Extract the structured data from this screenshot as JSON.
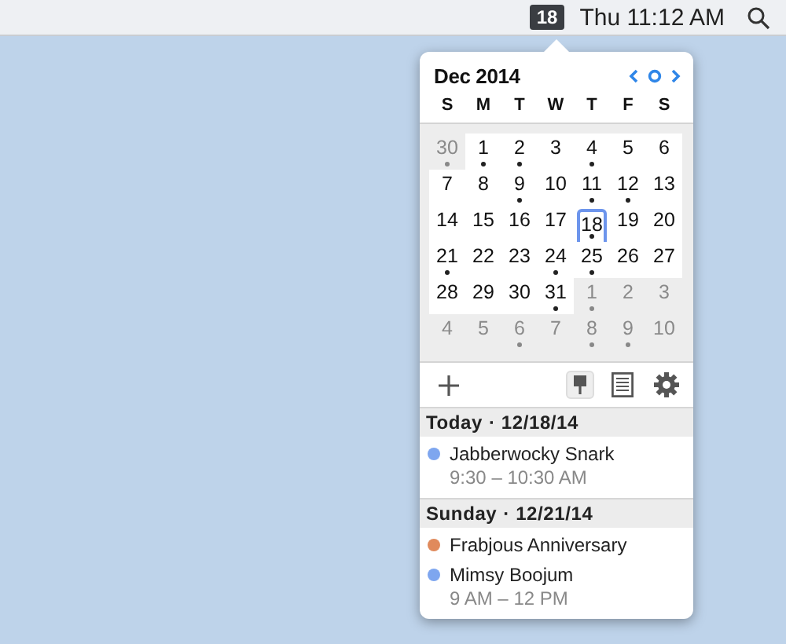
{
  "menu_bar": {
    "date_badge": "18",
    "clock": "Thu 11:12 AM"
  },
  "calendar": {
    "month": "Dec 2014",
    "weekdays": [
      "S",
      "M",
      "T",
      "W",
      "T",
      "F",
      "S"
    ],
    "days": [
      {
        "label": "30",
        "in_month": false,
        "today": false,
        "has_event": true
      },
      {
        "label": "1",
        "in_month": true,
        "today": false,
        "has_event": true
      },
      {
        "label": "2",
        "in_month": true,
        "today": false,
        "has_event": true
      },
      {
        "label": "3",
        "in_month": true,
        "today": false,
        "has_event": false
      },
      {
        "label": "4",
        "in_month": true,
        "today": false,
        "has_event": true
      },
      {
        "label": "5",
        "in_month": true,
        "today": false,
        "has_event": false
      },
      {
        "label": "6",
        "in_month": true,
        "today": false,
        "has_event": false
      },
      {
        "label": "7",
        "in_month": true,
        "today": false,
        "has_event": false
      },
      {
        "label": "8",
        "in_month": true,
        "today": false,
        "has_event": false
      },
      {
        "label": "9",
        "in_month": true,
        "today": false,
        "has_event": true
      },
      {
        "label": "10",
        "in_month": true,
        "today": false,
        "has_event": false
      },
      {
        "label": "11",
        "in_month": true,
        "today": false,
        "has_event": true
      },
      {
        "label": "12",
        "in_month": true,
        "today": false,
        "has_event": true
      },
      {
        "label": "13",
        "in_month": true,
        "today": false,
        "has_event": false
      },
      {
        "label": "14",
        "in_month": true,
        "today": false,
        "has_event": false
      },
      {
        "label": "15",
        "in_month": true,
        "today": false,
        "has_event": false
      },
      {
        "label": "16",
        "in_month": true,
        "today": false,
        "has_event": false
      },
      {
        "label": "17",
        "in_month": true,
        "today": false,
        "has_event": false
      },
      {
        "label": "18",
        "in_month": true,
        "today": true,
        "has_event": true
      },
      {
        "label": "19",
        "in_month": true,
        "today": false,
        "has_event": false
      },
      {
        "label": "20",
        "in_month": true,
        "today": false,
        "has_event": false
      },
      {
        "label": "21",
        "in_month": true,
        "today": false,
        "has_event": true
      },
      {
        "label": "22",
        "in_month": true,
        "today": false,
        "has_event": false
      },
      {
        "label": "23",
        "in_month": true,
        "today": false,
        "has_event": false
      },
      {
        "label": "24",
        "in_month": true,
        "today": false,
        "has_event": true
      },
      {
        "label": "25",
        "in_month": true,
        "today": false,
        "has_event": true
      },
      {
        "label": "26",
        "in_month": true,
        "today": false,
        "has_event": false
      },
      {
        "label": "27",
        "in_month": true,
        "today": false,
        "has_event": false
      },
      {
        "label": "28",
        "in_month": true,
        "today": false,
        "has_event": false
      },
      {
        "label": "29",
        "in_month": true,
        "today": false,
        "has_event": false
      },
      {
        "label": "30",
        "in_month": true,
        "today": false,
        "has_event": false
      },
      {
        "label": "31",
        "in_month": true,
        "today": false,
        "has_event": true
      },
      {
        "label": "1",
        "in_month": false,
        "today": false,
        "has_event": true
      },
      {
        "label": "2",
        "in_month": false,
        "today": false,
        "has_event": false
      },
      {
        "label": "3",
        "in_month": false,
        "today": false,
        "has_event": false
      },
      {
        "label": "4",
        "in_month": false,
        "today": false,
        "has_event": false
      },
      {
        "label": "5",
        "in_month": false,
        "today": false,
        "has_event": false
      },
      {
        "label": "6",
        "in_month": false,
        "today": false,
        "has_event": true
      },
      {
        "label": "7",
        "in_month": false,
        "today": false,
        "has_event": false
      },
      {
        "label": "8",
        "in_month": false,
        "today": false,
        "has_event": true
      },
      {
        "label": "9",
        "in_month": false,
        "today": false,
        "has_event": true
      },
      {
        "label": "10",
        "in_month": false,
        "today": false,
        "has_event": false
      }
    ]
  },
  "toolbar": [
    {
      "kind": "add",
      "pressed": false
    },
    {
      "kind": "pin",
      "pressed": true
    },
    {
      "kind": "notes",
      "pressed": false
    },
    {
      "kind": "settings",
      "pressed": false
    }
  ],
  "agenda": [
    {
      "day": "Today",
      "date": "· 12/18/14",
      "events": [
        {
          "title": "Jabberwocky Snark",
          "time": "9:30 – 10:30 AM",
          "color": "#7ea6ef"
        }
      ]
    },
    {
      "day": "Sunday",
      "date": "· 12/21/14",
      "events": [
        {
          "title": "Frabjous Anniversary",
          "color": "#e08a5c"
        },
        {
          "title": "Mimsy Boojum",
          "time": "9 AM – 12 PM",
          "color": "#7ea6ef"
        }
      ]
    }
  ]
}
